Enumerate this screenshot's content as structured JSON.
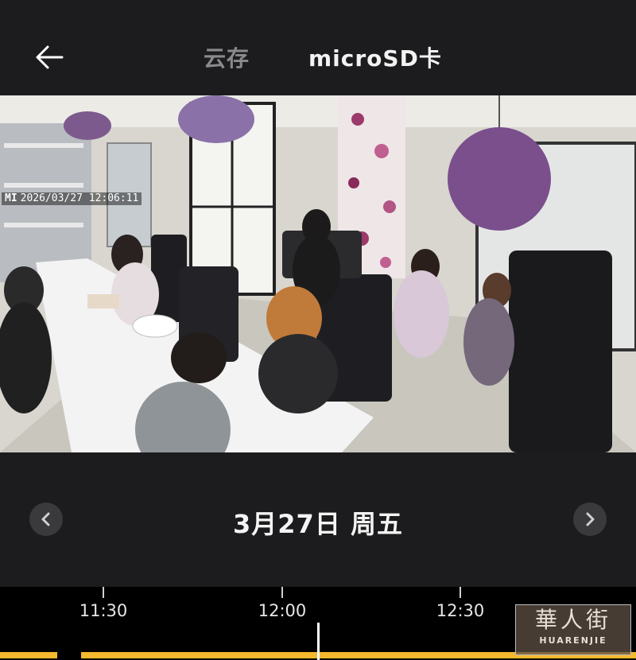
{
  "header": {
    "tabs": [
      {
        "label": "云存",
        "active": false
      },
      {
        "label": "microSD卡",
        "active": true
      }
    ]
  },
  "video": {
    "timestamp": "2026/03/27  12:06:11",
    "camera_brand": "MI"
  },
  "date_nav": {
    "date_label": "3月27日 周五"
  },
  "timeline": {
    "ticks": [
      "11:30",
      "12:00",
      "12:30"
    ],
    "record_color": "#f5b92e"
  },
  "watermark": {
    "cn": "華人街",
    "en": "HUARENJIE"
  },
  "colors": {
    "background": "#1c1c1e",
    "active_tab": "#f2f2f2",
    "inactive_tab": "#8a8a8e"
  }
}
